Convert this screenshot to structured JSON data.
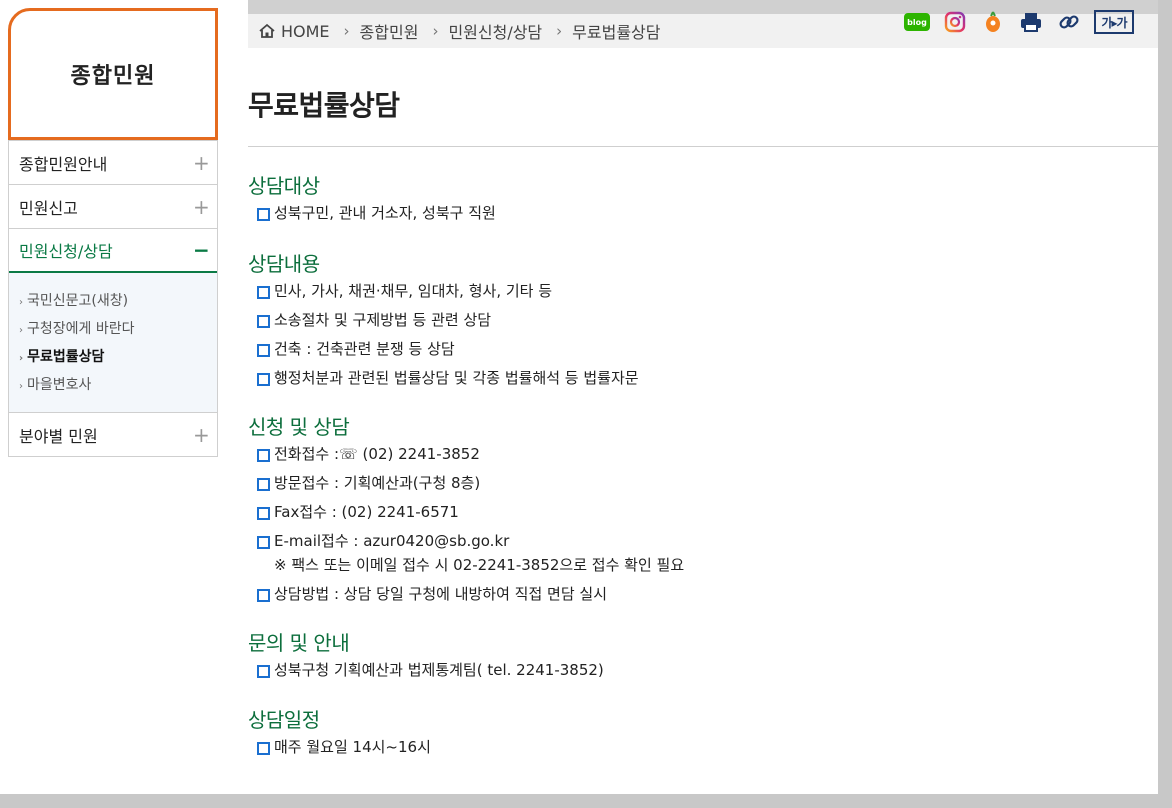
{
  "sidebar": {
    "title": "종합민원",
    "items": [
      {
        "label": "종합민원안내",
        "toggle": "+"
      },
      {
        "label": "민원신고",
        "toggle": "+"
      },
      {
        "label": "민원신청/상담",
        "toggle": "−"
      },
      {
        "label": "분야별 민원",
        "toggle": "+"
      }
    ],
    "subitems": [
      {
        "label": "국민신문고(새창)"
      },
      {
        "label": "구청장에게 바란다"
      },
      {
        "label": "무료법률상담"
      },
      {
        "label": "마을변호사"
      }
    ],
    "sub_arrow": "›"
  },
  "breadcrumb": {
    "home": "HOME",
    "sep": "›",
    "level1": "종합민원",
    "level2": "민원신청/상담",
    "level3": "무료법률상담"
  },
  "toolbar": {
    "blog_label": "blog",
    "font_size_label": "가▸가"
  },
  "page": {
    "title": "무료법률상담"
  },
  "sections": [
    {
      "title": "상담대상",
      "items": [
        "성북구민, 관내 거소자, 성북구 직원"
      ]
    },
    {
      "title": "상담내용",
      "items": [
        "민사, 가사, 채권·채무, 임대차, 형사, 기타 등",
        "소송절차 및 구제방법 등 관련 상담",
        "건축 : 건축관련 분쟁 등 상담",
        "행정처분과 관련된 법률상담 및 각종 법률해석 등 법률자문"
      ]
    },
    {
      "title": "신청 및 상담",
      "items": [
        "전화접수 :☏ (02) 2241-3852",
        "방문접수 : 기획예산과(구청 8층)",
        "Fax접수 : (02) 2241-6571",
        "E-mail접수 : azur0420@sb.go.kr",
        "상담방법 : 상담 당일 구청에 내방하여 직접 면담 실시"
      ],
      "note": "※ 팩스 또는 이메일 접수 시 02-2241-3852으로 접수 확인 필요"
    },
    {
      "title": "문의 및 안내",
      "items": [
        "성북구청 기획예산과 법제통계팀( tel. 2241-3852)"
      ]
    },
    {
      "title": "상담일정",
      "items": [
        "매주 월요일 14시~16시"
      ]
    }
  ],
  "colors": {
    "accent_orange": "#e56b1f",
    "section_green": "#0c6e3c",
    "bullet_blue": "#1a6fd0"
  }
}
